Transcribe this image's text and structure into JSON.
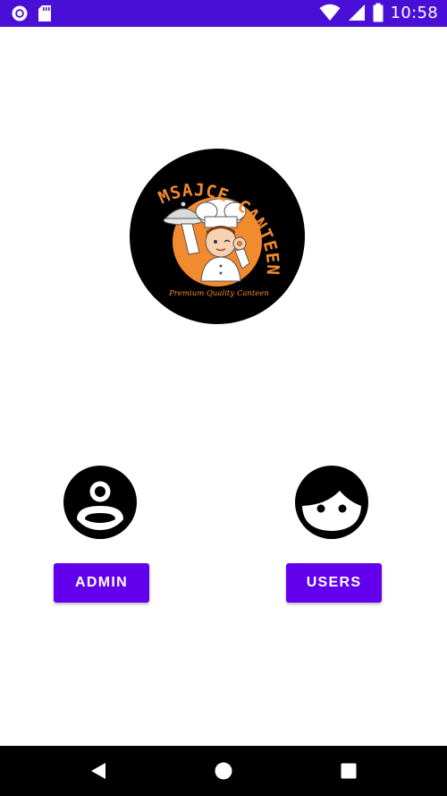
{
  "status_bar": {
    "time": "10:58",
    "icons": [
      "notification-ring-icon",
      "sd-card-icon",
      "wifi-icon",
      "signal-icon",
      "battery-icon"
    ],
    "background_color": "#4a0fd6"
  },
  "logo": {
    "title": "MSAJCE CANTEEN",
    "tagline": "Premium Quality Canteen",
    "title_color": "#f28a2e",
    "badge_background": "#000000"
  },
  "roles": {
    "admin": {
      "icon": "account-circle-icon",
      "label": "ADMIN"
    },
    "users": {
      "icon": "face-icon",
      "label": "USERS"
    }
  },
  "nav_bar": {
    "icons": [
      "back-icon",
      "home-icon",
      "recents-icon"
    ]
  },
  "colors": {
    "accent": "#6200ee",
    "status_bar": "#4a0fd6",
    "nav_bar": "#000000"
  }
}
